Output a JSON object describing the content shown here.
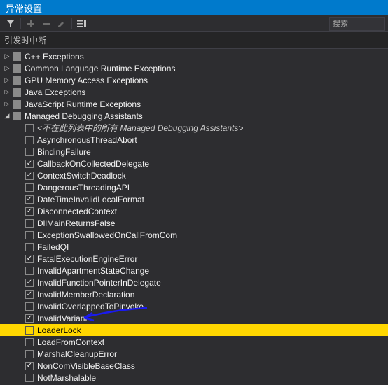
{
  "title": "异常设置",
  "toolbar": {
    "filter_icon": "filter-icon",
    "add_icon": "add-icon",
    "minus_icon": "minus-icon",
    "edit_icon": "edit-icon",
    "settings_icon": "options-icon",
    "search_placeholder": "搜索"
  },
  "section_header": "引发时中断",
  "categories": [
    {
      "expanded": false,
      "state": "filled",
      "label": "C++ Exceptions"
    },
    {
      "expanded": false,
      "state": "filled",
      "label": "Common Language Runtime Exceptions"
    },
    {
      "expanded": false,
      "state": "filled",
      "label": "GPU Memory Access Exceptions"
    },
    {
      "expanded": false,
      "state": "filled",
      "label": "Java Exceptions"
    },
    {
      "expanded": false,
      "state": "filled",
      "label": "JavaScript Runtime Exceptions"
    },
    {
      "expanded": true,
      "state": "filled",
      "label": "Managed Debugging Assistants",
      "children": [
        {
          "state": "none",
          "label": "<不在此列表中的所有 Managed Debugging Assistants>",
          "italic": true
        },
        {
          "state": "none",
          "label": "AsynchronousThreadAbort"
        },
        {
          "state": "none",
          "label": "BindingFailure"
        },
        {
          "state": "checked",
          "label": "CallbackOnCollectedDelegate"
        },
        {
          "state": "checked",
          "label": "ContextSwitchDeadlock"
        },
        {
          "state": "none",
          "label": "DangerousThreadingAPI"
        },
        {
          "state": "checked",
          "label": "DateTimeInvalidLocalFormat"
        },
        {
          "state": "checked",
          "label": "DisconnectedContext"
        },
        {
          "state": "none",
          "label": "DllMainReturnsFalse"
        },
        {
          "state": "none",
          "label": "ExceptionSwallowedOnCallFromCom"
        },
        {
          "state": "none",
          "label": "FailedQI"
        },
        {
          "state": "checked",
          "label": "FatalExecutionEngineError"
        },
        {
          "state": "none",
          "label": "InvalidApartmentStateChange"
        },
        {
          "state": "checked",
          "label": "InvalidFunctionPointerInDelegate"
        },
        {
          "state": "checked",
          "label": "InvalidMemberDeclaration"
        },
        {
          "state": "none",
          "label": "InvalidOverlappedToPinvoke"
        },
        {
          "state": "checked",
          "label": "InvalidVariant"
        },
        {
          "state": "none",
          "label": "LoaderLock",
          "highlight": true
        },
        {
          "state": "none",
          "label": "LoadFromContext"
        },
        {
          "state": "none",
          "label": "MarshalCleanupError"
        },
        {
          "state": "checked",
          "label": "NonComVisibleBaseClass"
        },
        {
          "state": "none",
          "label": "NotMarshalable"
        }
      ]
    }
  ]
}
